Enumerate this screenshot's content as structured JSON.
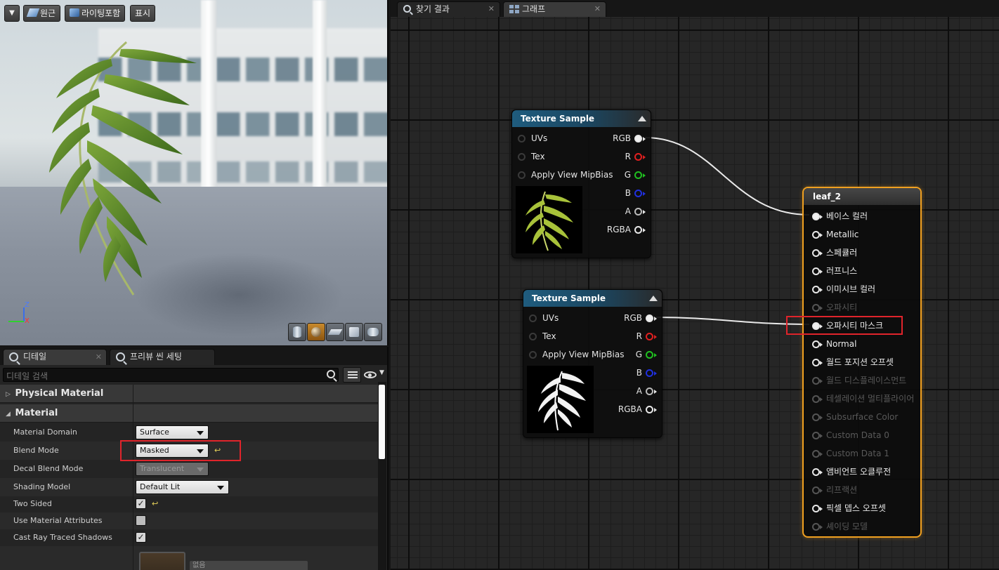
{
  "viewport": {
    "buttons": {
      "perspective": "원근",
      "lit": "라이팅포함",
      "show": "표시"
    },
    "axis": {
      "z": "Z",
      "x": "X"
    }
  },
  "details": {
    "tabs": [
      {
        "label": "디테일"
      },
      {
        "label": "프리뷰 씬 세팅"
      }
    ],
    "search_placeholder": "디테일 검색",
    "categories": {
      "physical_material": "Physical Material",
      "material": "Material"
    },
    "props": {
      "material_domain": {
        "label": "Material Domain",
        "value": "Surface"
      },
      "blend_mode": {
        "label": "Blend Mode",
        "value": "Masked"
      },
      "decal_blend_mode": {
        "label": "Decal Blend Mode",
        "value": "Translucent"
      },
      "shading_model": {
        "label": "Shading Model",
        "value": "Default Lit"
      },
      "two_sided": {
        "label": "Two Sided",
        "checked": true
      },
      "use_material_attributes": {
        "label": "Use Material Attributes",
        "checked": false
      },
      "cast_ray_traced_shadows": {
        "label": "Cast Ray Traced Shadows",
        "checked": true
      }
    },
    "texture_dropdown": "없음"
  },
  "graph": {
    "tabs": [
      {
        "label": "찾기 결과"
      },
      {
        "label": "그래프"
      }
    ],
    "texture_nodes": [
      {
        "title": "Texture Sample",
        "inputs": [
          "UVs",
          "Tex",
          "Apply View MipBias"
        ],
        "outputs": [
          "RGB",
          "R",
          "G",
          "B",
          "A",
          "RGBA"
        ]
      },
      {
        "title": "Texture Sample",
        "inputs": [
          "UVs",
          "Tex",
          "Apply View MipBias"
        ],
        "outputs": [
          "RGB",
          "R",
          "G",
          "B",
          "A",
          "RGBA"
        ]
      }
    ],
    "material_node": {
      "title": "leaf_2",
      "pins": [
        {
          "label": "베이스 컬러",
          "enabled": true
        },
        {
          "label": "Metallic",
          "enabled": true
        },
        {
          "label": "스페큘러",
          "enabled": true
        },
        {
          "label": "러프니스",
          "enabled": true
        },
        {
          "label": "이미시브 컬러",
          "enabled": true
        },
        {
          "label": "오파시티",
          "enabled": false
        },
        {
          "label": "오파시티 마스크",
          "enabled": true
        },
        {
          "label": "Normal",
          "enabled": true
        },
        {
          "label": "월드 포지션 오프셋",
          "enabled": true
        },
        {
          "label": "월드 디스플레이스먼트",
          "enabled": false
        },
        {
          "label": "테셀레이션 멀티플라이어",
          "enabled": false
        },
        {
          "label": "Subsurface Color",
          "enabled": false
        },
        {
          "label": "Custom Data 0",
          "enabled": false
        },
        {
          "label": "Custom Data 1",
          "enabled": false
        },
        {
          "label": "앰비언트 오클루전",
          "enabled": true
        },
        {
          "label": "리프랙션",
          "enabled": false
        },
        {
          "label": "픽셀 뎁스 오프셋",
          "enabled": true
        },
        {
          "label": "셰이딩 모델",
          "enabled": false
        }
      ]
    },
    "pin_colors": {
      "R": "#e02020",
      "G": "#20c020",
      "B": "#2030e0",
      "A": "#dddddd"
    }
  }
}
